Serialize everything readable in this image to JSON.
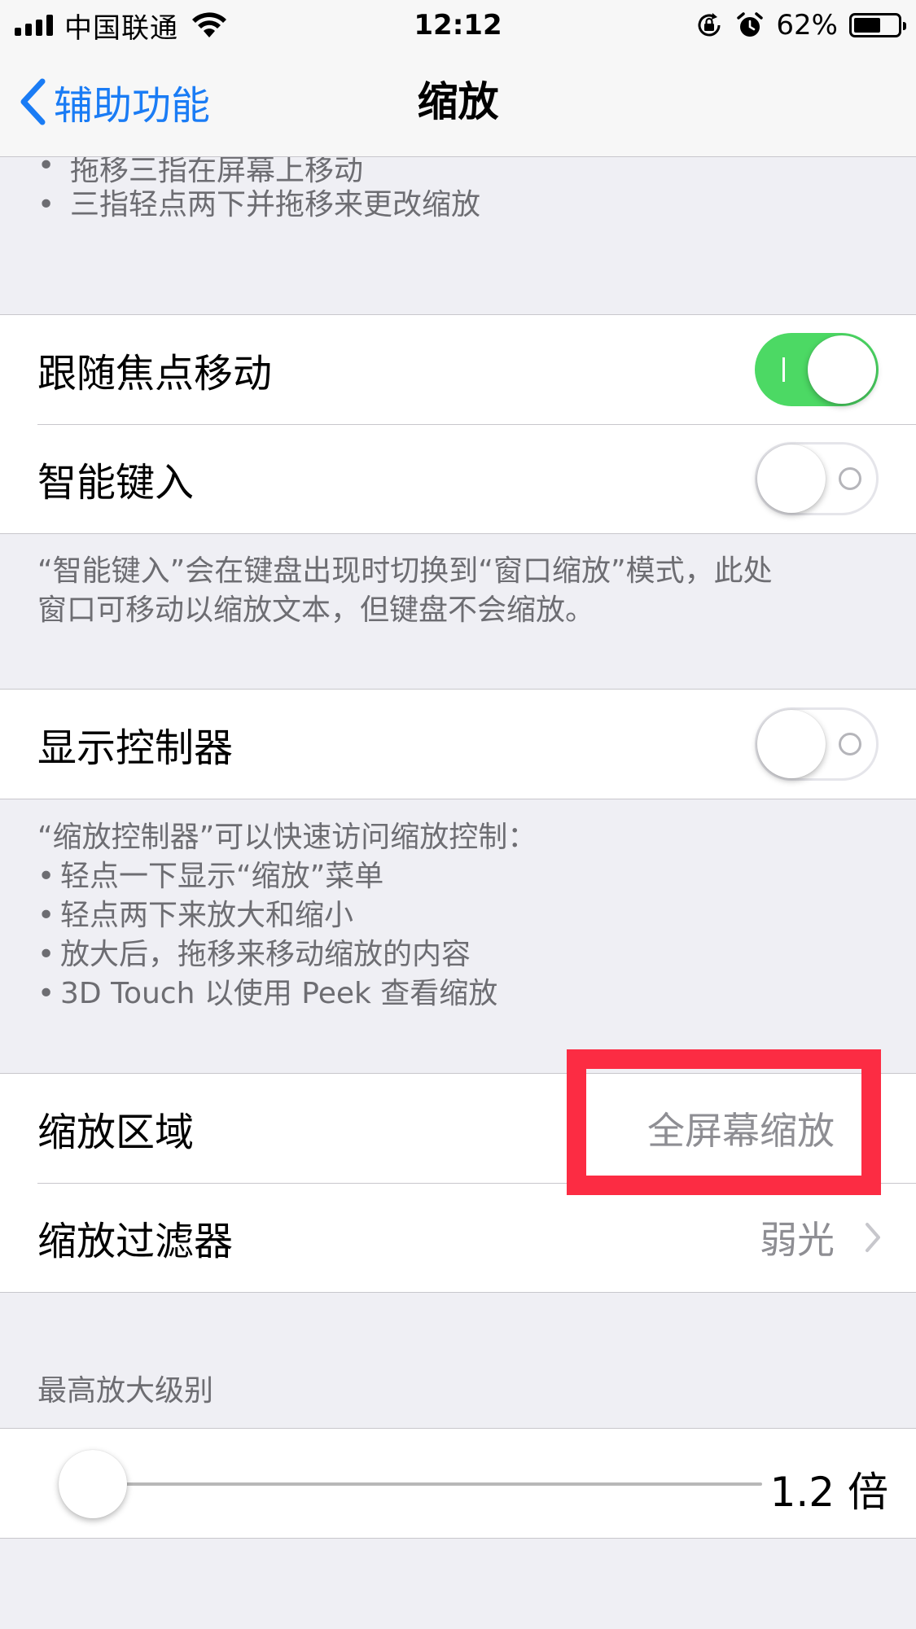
{
  "status_bar": {
    "carrier": "中国联通",
    "time": "12:12",
    "battery_percent": "62%",
    "battery_level": 0.62
  },
  "nav": {
    "back_label": "辅助功能",
    "title": "缩放"
  },
  "top_footer": {
    "bullets": [
      "拖移三指在屏幕上移动",
      "三指轻点两下并拖移来更改缩放"
    ]
  },
  "group1": {
    "follow_focus": {
      "label": "跟随焦点移动",
      "on": true
    },
    "smart_typing": {
      "label": "智能键入",
      "on": false
    }
  },
  "smart_typing_footer": [
    "“智能键入”会在键盘出现时切换到“窗口缩放”模式，此处",
    "窗口可移动以缩放文本，但键盘不会缩放。"
  ],
  "group2": {
    "show_controller": {
      "label": "显示控制器",
      "on": false
    }
  },
  "controller_footer": {
    "intro": "“缩放控制器”可以快速访问缩放控制：",
    "bullets": [
      "轻点一下显示“缩放”菜单",
      "轻点两下来放大和缩小",
      "放大后，拖移来移动缩放的内容",
      "3D Touch 以使用 Peek 查看缩放"
    ]
  },
  "group3": {
    "zoom_region": {
      "label": "缩放区域",
      "value": "全屏幕缩放"
    },
    "zoom_filter": {
      "label": "缩放过滤器",
      "value": "弱光"
    }
  },
  "max_zoom": {
    "header": "最高放大级别",
    "value_text": "1.2 倍",
    "slider_fraction": 0.0
  },
  "colors": {
    "accent": "#1a7cf5",
    "toggle_on": "#4cd964",
    "highlight": "#fc2c43"
  }
}
